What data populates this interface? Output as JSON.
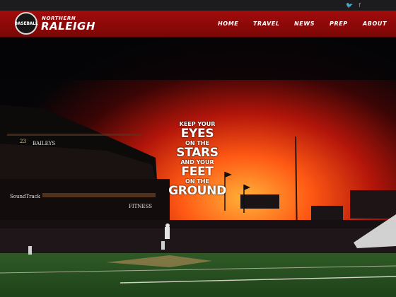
{
  "social": {
    "twitter": "🐦",
    "facebook": "f"
  },
  "logo": {
    "badge_text": "BASEBALL",
    "line1": "NORTHERN",
    "line2": "RALEIGH"
  },
  "nav": [
    {
      "label": "HOME"
    },
    {
      "label": "TRAVEL"
    },
    {
      "label": "NEWS"
    },
    {
      "label": "PREP"
    },
    {
      "label": "ABOUT"
    }
  ],
  "hero": {
    "tagline": {
      "l1": "KEEP YOUR",
      "l2": "EYES",
      "l3": "ON THE",
      "l4": "STARS",
      "l5": "AND YOUR",
      "l6": "FEET",
      "l7": "ON THE",
      "l8": "GROUND"
    },
    "signs": {
      "baileys": "BAILEYS",
      "soundtrack": "SoundTrack",
      "fitness": "FITNESS",
      "score": "23"
    }
  },
  "colors": {
    "nav_red": "#a20c0c",
    "sky_orange": "#ff4a10",
    "field_green": "#2e6b2a"
  }
}
